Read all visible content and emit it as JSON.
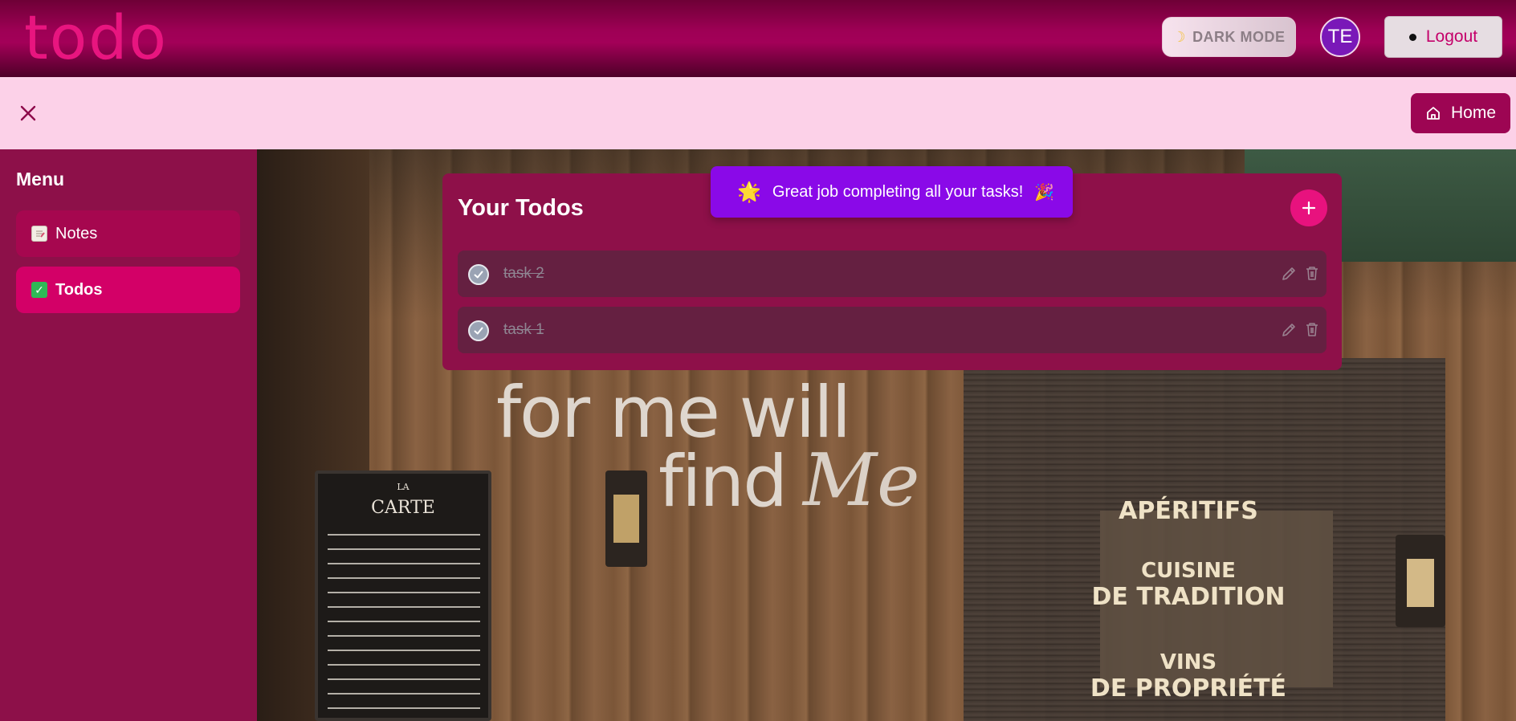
{
  "header": {
    "logo": "todo",
    "dark_mode_label": "DARK MODE",
    "avatar_initials": "TE",
    "logout_label": "Logout"
  },
  "subbar": {
    "home_label": "Home"
  },
  "sidebar": {
    "title": "Menu",
    "items": [
      {
        "label": "Notes",
        "icon": "notepad-icon",
        "active": false
      },
      {
        "label": "Todos",
        "icon": "checkbox-icon",
        "active": true
      }
    ]
  },
  "todos": {
    "title": "Your Todos",
    "items": [
      {
        "text": "task 2",
        "completed": true
      },
      {
        "text": "task 1",
        "completed": true
      }
    ]
  },
  "toast": {
    "message": "Great job completing all your tasks!",
    "leading_emoji": "🌟",
    "trailing_emoji": "🎉"
  },
  "background": {
    "glass_text_line1": "for me will",
    "glass_text_line2": "find",
    "glass_text_line3": "Me",
    "board_small": "LA",
    "board_title": "CARTE",
    "sign_1": "APÉRITIFS",
    "sign_2": "CUISINE",
    "sign_3": "DE TRADITION",
    "sign_4": "VINS",
    "sign_5": "DE PROPRIÉTÉ"
  },
  "colors": {
    "brand": "#e8157f",
    "header": "#9e0055",
    "subbar": "#fcd1e8",
    "sidebar": "#8d1049",
    "active_item": "#d30067",
    "toast": "#8a09e8"
  }
}
